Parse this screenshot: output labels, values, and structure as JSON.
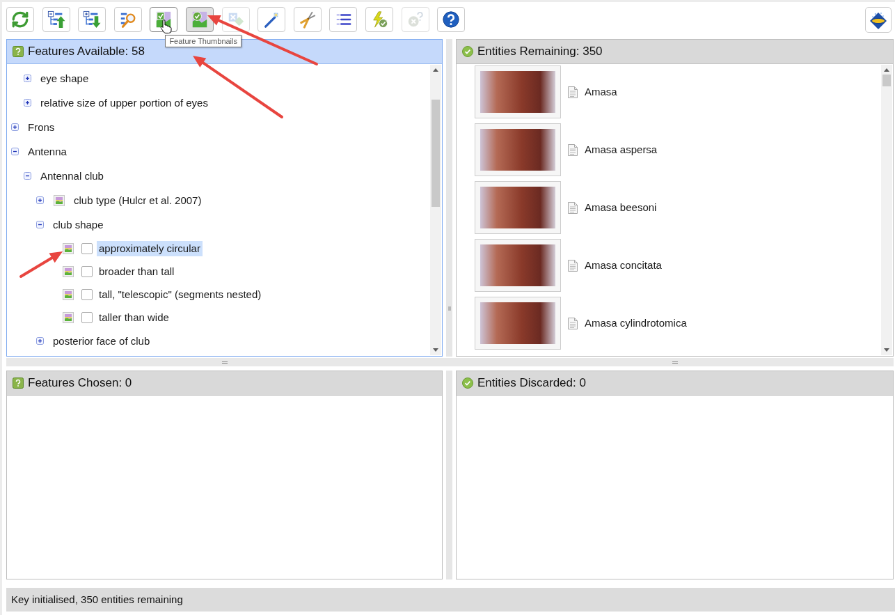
{
  "toolbar": {
    "buttons": [
      {
        "kind": "refresh",
        "pressed": false,
        "disabled": false,
        "hovered": false
      },
      {
        "kind": "collapse",
        "pressed": false,
        "disabled": false,
        "hovered": false
      },
      {
        "kind": "expand",
        "pressed": false,
        "disabled": false,
        "hovered": false
      },
      {
        "kind": "search",
        "pressed": false,
        "disabled": false,
        "hovered": false
      },
      {
        "kind": "featurethumbs",
        "pressed": false,
        "disabled": false,
        "hovered": true,
        "tooltip": "Feature Thumbnails"
      },
      {
        "kind": "entitythumbs",
        "pressed": true,
        "disabled": false,
        "hovered": false
      },
      {
        "kind": "swap",
        "pressed": false,
        "disabled": true,
        "hovered": false
      },
      {
        "kind": "wand",
        "pressed": false,
        "disabled": false,
        "hovered": false
      },
      {
        "kind": "pliers",
        "pressed": false,
        "disabled": false,
        "hovered": false
      },
      {
        "kind": "checklist",
        "pressed": false,
        "disabled": false,
        "hovered": false
      },
      {
        "kind": "lightning",
        "pressed": false,
        "disabled": false,
        "hovered": false
      },
      {
        "kind": "uncertain",
        "pressed": false,
        "disabled": true,
        "hovered": false
      },
      {
        "kind": "help",
        "pressed": false,
        "disabled": false,
        "hovered": false
      }
    ]
  },
  "panels": [
    {
      "kind": "features",
      "title": "Features Available: 58",
      "selected": true,
      "tree": [
        {
          "expanded": true,
          "children": [
            {
              "kind": "feature",
              "label": "eye shape",
              "expanded": false,
              "thumbnail": false,
              "selected": false
            },
            {
              "kind": "feature",
              "label": "relative size of upper portion of eyes",
              "expanded": false,
              "thumbnail": false,
              "selected": false
            }
          ]
        },
        {
          "kind": "feature",
          "label": "Frons",
          "expanded": false,
          "thumbnail": false,
          "selected": false
        },
        {
          "kind": "feature",
          "label": "Antenna",
          "expanded": true,
          "thumbnail": false,
          "selected": false,
          "children": [
            {
              "kind": "feature",
              "label": "Antennal club",
              "expanded": true,
              "thumbnail": false,
              "selected": false,
              "children": [
                {
                  "kind": "feature",
                  "label": "club type (Hulcr et al. 2007)",
                  "expanded": false,
                  "thumbnail": true,
                  "selected": false
                },
                {
                  "kind": "feature",
                  "label": "club shape",
                  "expanded": true,
                  "thumbnail": false,
                  "selected": false,
                  "children": [
                    {
                      "kind": "state",
                      "label": "approximately circular",
                      "thumbnail": true,
                      "checked": false,
                      "selected": true
                    },
                    {
                      "kind": "state",
                      "label": "broader than tall",
                      "thumbnail": true,
                      "checked": false,
                      "selected": false
                    },
                    {
                      "kind": "state",
                      "label": "tall, \"telescopic\" (segments nested)",
                      "thumbnail": true,
                      "checked": false,
                      "selected": false
                    },
                    {
                      "kind": "state",
                      "label": "taller than wide",
                      "thumbnail": true,
                      "checked": false,
                      "selected": false
                    }
                  ]
                },
                {
                  "kind": "feature",
                  "label": "posterior face of club",
                  "expanded": false,
                  "thumbnail": false,
                  "selected": false
                }
              ]
            }
          ]
        }
      ]
    },
    {
      "kind": "entities",
      "title": "Entities Remaining: 350",
      "selected": false,
      "entities": [
        {
          "name": "Amasa"
        },
        {
          "name": "Amasa aspersa"
        },
        {
          "name": "Amasa beesoni"
        },
        {
          "name": "Amasa concitata"
        },
        {
          "name": "Amasa cylindrotomica"
        }
      ]
    },
    {
      "kind": "features",
      "title": "Features Chosen: 0",
      "selected": false
    },
    {
      "kind": "entities",
      "title": "Entities Discarded: 0",
      "selected": false
    }
  ],
  "status_bar": {
    "text": "Key initialised, 350 entities remaining"
  }
}
